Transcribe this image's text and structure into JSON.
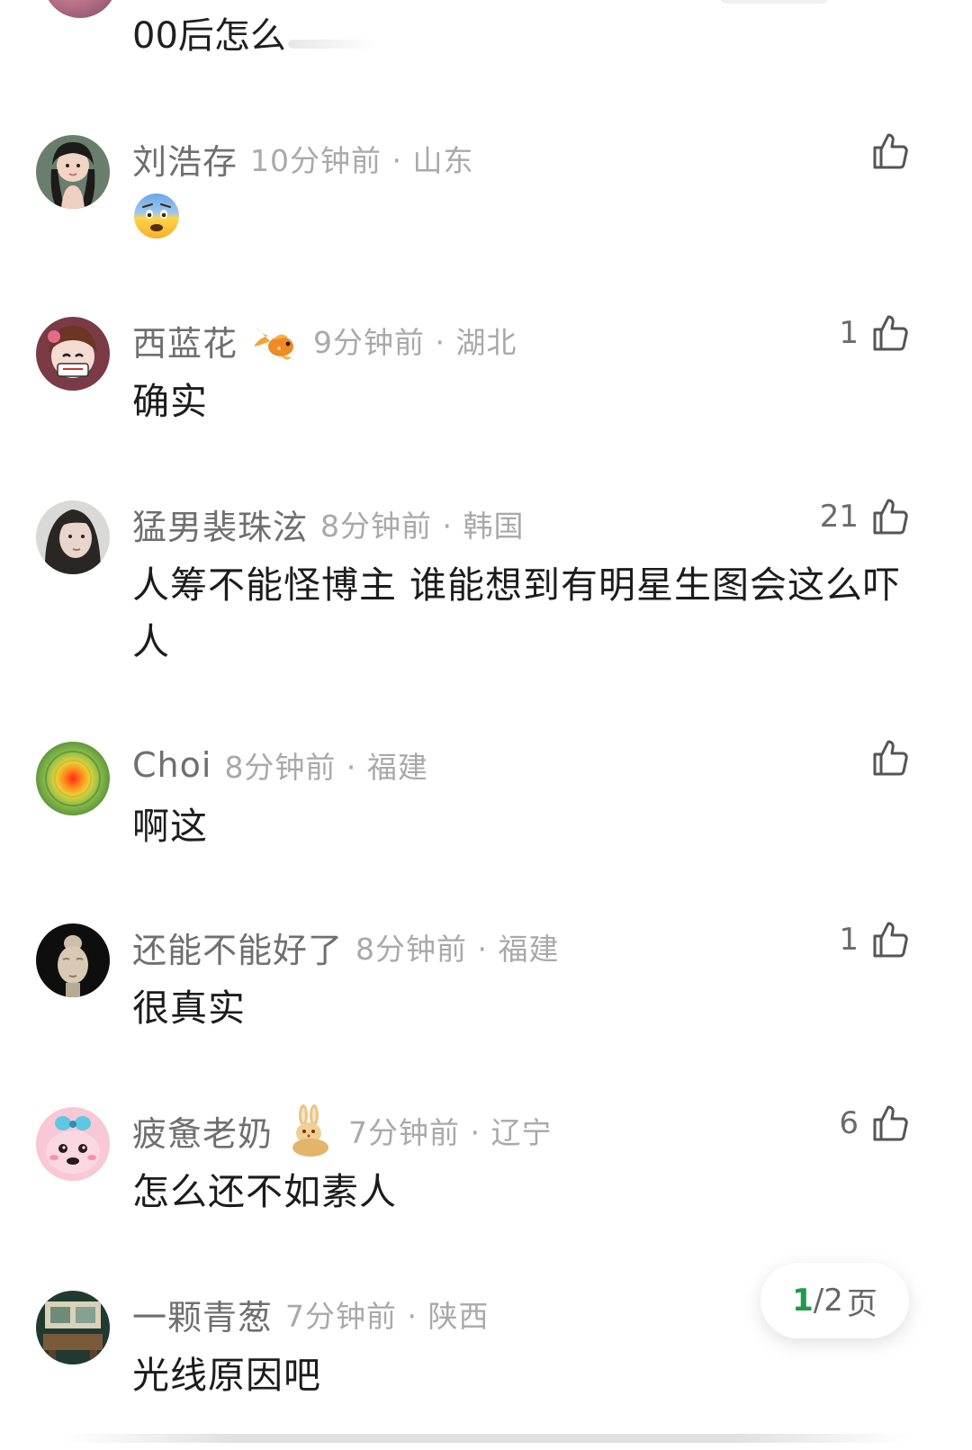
{
  "top_fragment": {
    "text": "00后怎么"
  },
  "comments": [
    {
      "username": "刘浩存",
      "time": "10分钟前",
      "location": "山东",
      "body": "",
      "emoji": "fearful-face-icon",
      "likes": ""
    },
    {
      "username": "西蓝花",
      "badge": "goldfish-icon",
      "time": "9分钟前",
      "location": "湖北",
      "body": "确实",
      "likes": "1"
    },
    {
      "username": "猛男裴珠泫",
      "time": "8分钟前",
      "location": "韩国",
      "body": "人筹不能怪博主 谁能想到有明星生图会这么吓人",
      "likes": "21"
    },
    {
      "username": "Choi",
      "time": "8分钟前",
      "location": "福建",
      "body": "啊这",
      "likes": ""
    },
    {
      "username": "还能不能好了",
      "time": "8分钟前",
      "location": "福建",
      "body": "很真实",
      "likes": "1"
    },
    {
      "username": "疲惫老奶",
      "badge": "rabbit-icon",
      "time": "7分钟前",
      "location": "辽宁",
      "body": "怎么还不如素人",
      "likes": "6"
    },
    {
      "username": "一颗青葱",
      "time": "7分钟前",
      "location": "陕西",
      "body": "光线原因吧",
      "likes": ""
    }
  ],
  "pager": {
    "current": "1",
    "separator": "/",
    "total": "2",
    "suffix": "页"
  },
  "colors": {
    "username": "#6f6f6f",
    "meta": "#a9a9a9",
    "body": "#1c1c1c",
    "pager_current": "#1f9a4b"
  }
}
